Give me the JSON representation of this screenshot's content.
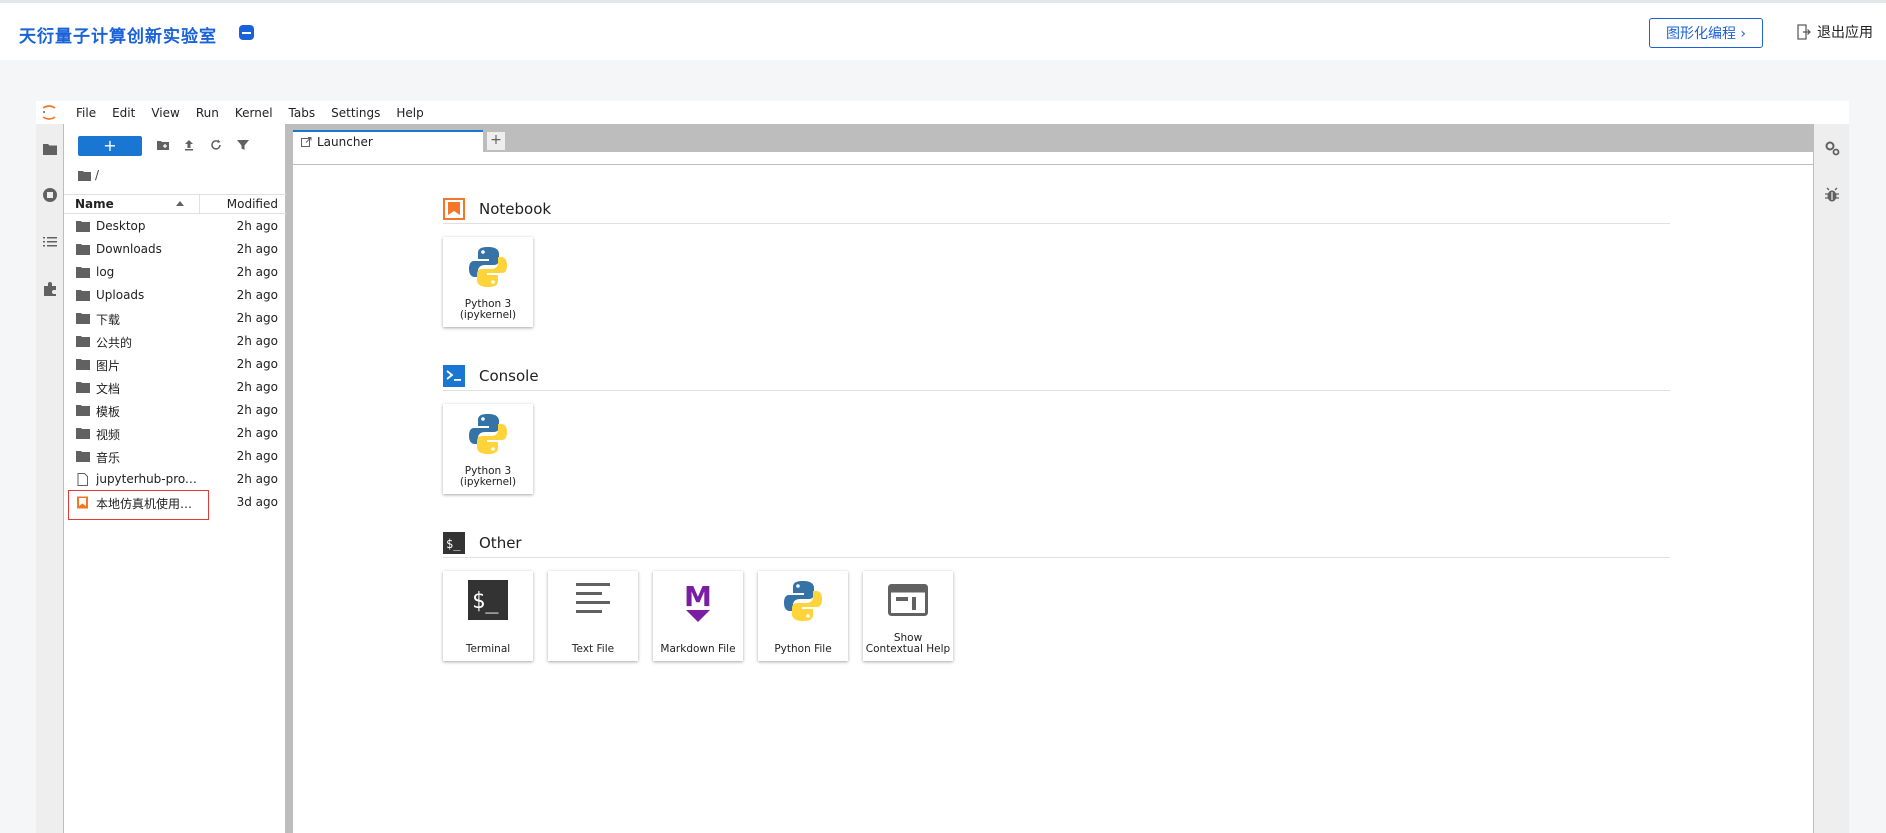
{
  "header": {
    "brand": "天衍量子计算创新实验室",
    "graph_button": "图形化编程 ›",
    "exit_label": "退出应用"
  },
  "menubar": {
    "items": [
      "File",
      "Edit",
      "View",
      "Run",
      "Kernel",
      "Tabs",
      "Settings",
      "Help"
    ]
  },
  "filebrowser": {
    "new_label": "+",
    "breadcrumb": "/",
    "col_name": "Name",
    "col_modified": "Modified",
    "rows": [
      {
        "name": "Desktop",
        "modified": "2h ago",
        "type": "folder"
      },
      {
        "name": "Downloads",
        "modified": "2h ago",
        "type": "folder"
      },
      {
        "name": "log",
        "modified": "2h ago",
        "type": "folder"
      },
      {
        "name": "Uploads",
        "modified": "2h ago",
        "type": "folder"
      },
      {
        "name": "下载",
        "modified": "2h ago",
        "type": "folder"
      },
      {
        "name": "公共的",
        "modified": "2h ago",
        "type": "folder"
      },
      {
        "name": "图片",
        "modified": "2h ago",
        "type": "folder"
      },
      {
        "name": "文档",
        "modified": "2h ago",
        "type": "folder"
      },
      {
        "name": "模板",
        "modified": "2h ago",
        "type": "folder"
      },
      {
        "name": "视频",
        "modified": "2h ago",
        "type": "folder"
      },
      {
        "name": "音乐",
        "modified": "2h ago",
        "type": "folder"
      },
      {
        "name": "jupyterhub-prox…",
        "modified": "2h ago",
        "type": "file"
      },
      {
        "name": "本地仿真机使用…",
        "modified": "3d ago",
        "type": "notebook"
      }
    ]
  },
  "tabs": {
    "active": "Launcher",
    "add_label": "+"
  },
  "launcher": {
    "notebook": {
      "title": "Notebook",
      "cards": [
        {
          "label": "Python 3\n(ipykernel)"
        }
      ]
    },
    "console": {
      "title": "Console",
      "cards": [
        {
          "label": "Python 3\n(ipykernel)"
        }
      ]
    },
    "other": {
      "title": "Other",
      "cards": [
        {
          "label": "Terminal"
        },
        {
          "label": "Text File"
        },
        {
          "label": "Markdown File"
        },
        {
          "label": "Python File"
        },
        {
          "label": "Show\nContextual Help"
        }
      ]
    }
  },
  "colors": {
    "brand": "#1a62d8",
    "accent": "#1976d2",
    "notebook_orange": "#f37726",
    "markdown_purple": "#7b1fa2"
  }
}
